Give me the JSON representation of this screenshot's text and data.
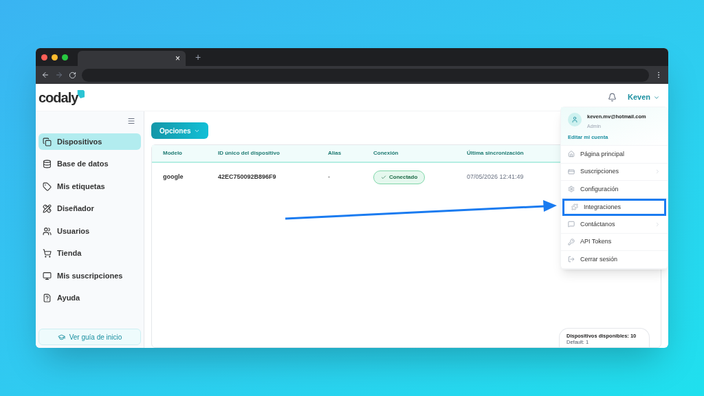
{
  "browser": {
    "tab_close": "×",
    "new_tab": "+"
  },
  "header": {
    "logo": "codaly",
    "user": "Keven"
  },
  "sidebar": {
    "items": [
      {
        "label": "Dispositivos",
        "selected": true
      },
      {
        "label": "Base de datos",
        "selected": false
      },
      {
        "label": "Mis etiquetas",
        "selected": false
      },
      {
        "label": "Diseñador",
        "selected": false
      },
      {
        "label": "Usuarios",
        "selected": false
      },
      {
        "label": "Tienda",
        "selected": false
      },
      {
        "label": "Mis suscripciones",
        "selected": false
      },
      {
        "label": "Ayuda",
        "selected": false
      }
    ],
    "guide_button": "Ver guía de inicio"
  },
  "options_button": "Opciones",
  "table": {
    "columns": [
      "Modelo",
      "ID único del dispositivo",
      "Alias",
      "Conexión",
      "Última sincronización"
    ],
    "rows": [
      {
        "model": "google",
        "device_id": "42EC750092B896F9",
        "alias": "-",
        "connection": "Conectado",
        "last_sync": "07/05/2026 12:41:49"
      }
    ]
  },
  "summary": {
    "available": "Dispositivos disponibles: 10",
    "default": "Default: 1"
  },
  "user_menu": {
    "email": "keven.mv@hotmail.com",
    "role": "Admin",
    "edit_link": "Editar mi cuenta",
    "items": [
      {
        "label": "Página principal",
        "submenu": false,
        "highlighted": false
      },
      {
        "label": "Suscripciones",
        "submenu": true,
        "highlighted": false
      },
      {
        "label": "Configuración",
        "submenu": false,
        "highlighted": false
      },
      {
        "label": "Integraciones",
        "submenu": false,
        "highlighted": true
      },
      {
        "label": "Contáctanos",
        "submenu": true,
        "highlighted": false
      },
      {
        "label": "API Tokens",
        "submenu": false,
        "highlighted": false
      },
      {
        "label": "Cerrar sesión",
        "submenu": false,
        "highlighted": false
      }
    ]
  }
}
